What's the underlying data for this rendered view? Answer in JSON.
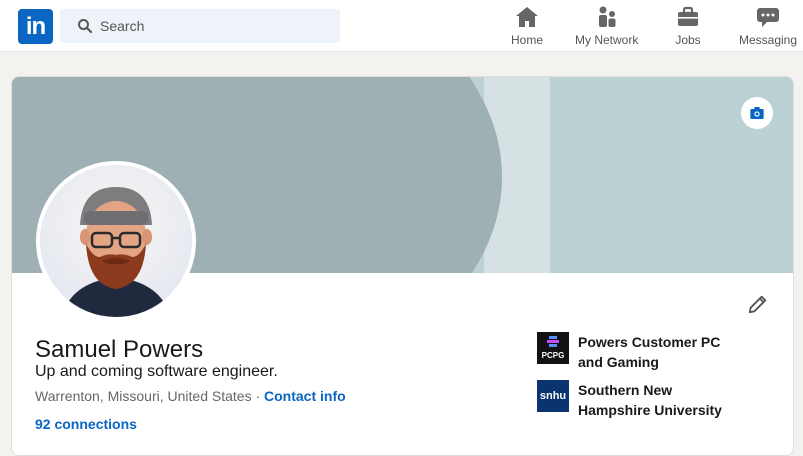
{
  "nav": {
    "logo_text": "in",
    "search_placeholder": "Search",
    "items": [
      {
        "label": "Home",
        "icon": "home-icon"
      },
      {
        "label": "My Network",
        "icon": "network-icon"
      },
      {
        "label": "Jobs",
        "icon": "briefcase-icon"
      },
      {
        "label": "Messaging",
        "icon": "chat-icon"
      }
    ]
  },
  "profile": {
    "name": "Samuel Powers",
    "headline": "Up and coming software engineer.",
    "location": "Warrenton, Missouri, United States",
    "separator": " · ",
    "contact_info": "Contact info",
    "connections": "92 connections"
  },
  "orgs": [
    {
      "name": "Powers Customer PC and Gaming",
      "logo_text": "PCPG"
    },
    {
      "name": "Southern New Hampshire University",
      "logo_text": "snhu"
    }
  ],
  "colors": {
    "brand": "#0a66c2",
    "banner": "#bcd1d4",
    "banner_arc": "#9fb0b4"
  }
}
